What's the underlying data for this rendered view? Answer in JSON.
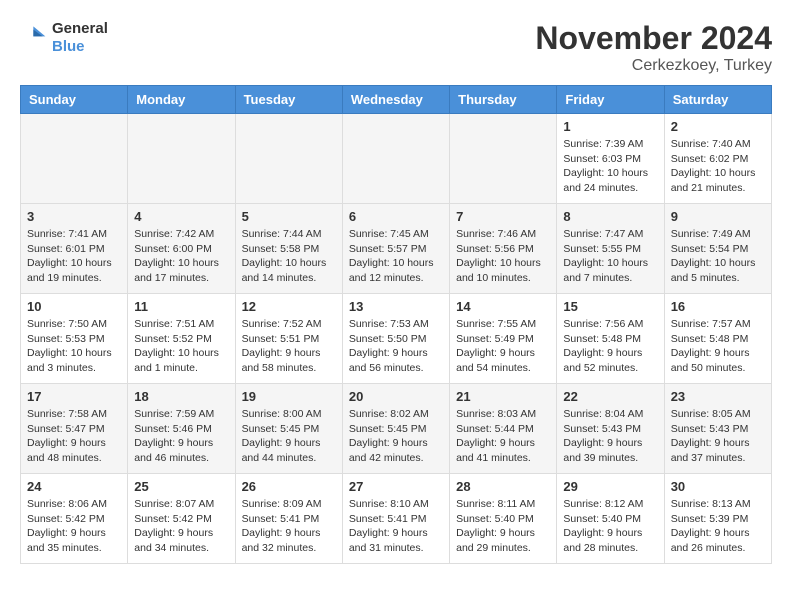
{
  "header": {
    "logo_line1": "General",
    "logo_line2": "Blue",
    "month_title": "November 2024",
    "location": "Cerkezkoey, Turkey"
  },
  "weekdays": [
    "Sunday",
    "Monday",
    "Tuesday",
    "Wednesday",
    "Thursday",
    "Friday",
    "Saturday"
  ],
  "weeks": [
    [
      {
        "day": "",
        "info": ""
      },
      {
        "day": "",
        "info": ""
      },
      {
        "day": "",
        "info": ""
      },
      {
        "day": "",
        "info": ""
      },
      {
        "day": "",
        "info": ""
      },
      {
        "day": "1",
        "info": "Sunrise: 7:39 AM\nSunset: 6:03 PM\nDaylight: 10 hours and 24 minutes."
      },
      {
        "day": "2",
        "info": "Sunrise: 7:40 AM\nSunset: 6:02 PM\nDaylight: 10 hours and 21 minutes."
      }
    ],
    [
      {
        "day": "3",
        "info": "Sunrise: 7:41 AM\nSunset: 6:01 PM\nDaylight: 10 hours and 19 minutes."
      },
      {
        "day": "4",
        "info": "Sunrise: 7:42 AM\nSunset: 6:00 PM\nDaylight: 10 hours and 17 minutes."
      },
      {
        "day": "5",
        "info": "Sunrise: 7:44 AM\nSunset: 5:58 PM\nDaylight: 10 hours and 14 minutes."
      },
      {
        "day": "6",
        "info": "Sunrise: 7:45 AM\nSunset: 5:57 PM\nDaylight: 10 hours and 12 minutes."
      },
      {
        "day": "7",
        "info": "Sunrise: 7:46 AM\nSunset: 5:56 PM\nDaylight: 10 hours and 10 minutes."
      },
      {
        "day": "8",
        "info": "Sunrise: 7:47 AM\nSunset: 5:55 PM\nDaylight: 10 hours and 7 minutes."
      },
      {
        "day": "9",
        "info": "Sunrise: 7:49 AM\nSunset: 5:54 PM\nDaylight: 10 hours and 5 minutes."
      }
    ],
    [
      {
        "day": "10",
        "info": "Sunrise: 7:50 AM\nSunset: 5:53 PM\nDaylight: 10 hours and 3 minutes."
      },
      {
        "day": "11",
        "info": "Sunrise: 7:51 AM\nSunset: 5:52 PM\nDaylight: 10 hours and 1 minute."
      },
      {
        "day": "12",
        "info": "Sunrise: 7:52 AM\nSunset: 5:51 PM\nDaylight: 9 hours and 58 minutes."
      },
      {
        "day": "13",
        "info": "Sunrise: 7:53 AM\nSunset: 5:50 PM\nDaylight: 9 hours and 56 minutes."
      },
      {
        "day": "14",
        "info": "Sunrise: 7:55 AM\nSunset: 5:49 PM\nDaylight: 9 hours and 54 minutes."
      },
      {
        "day": "15",
        "info": "Sunrise: 7:56 AM\nSunset: 5:48 PM\nDaylight: 9 hours and 52 minutes."
      },
      {
        "day": "16",
        "info": "Sunrise: 7:57 AM\nSunset: 5:48 PM\nDaylight: 9 hours and 50 minutes."
      }
    ],
    [
      {
        "day": "17",
        "info": "Sunrise: 7:58 AM\nSunset: 5:47 PM\nDaylight: 9 hours and 48 minutes."
      },
      {
        "day": "18",
        "info": "Sunrise: 7:59 AM\nSunset: 5:46 PM\nDaylight: 9 hours and 46 minutes."
      },
      {
        "day": "19",
        "info": "Sunrise: 8:00 AM\nSunset: 5:45 PM\nDaylight: 9 hours and 44 minutes."
      },
      {
        "day": "20",
        "info": "Sunrise: 8:02 AM\nSunset: 5:45 PM\nDaylight: 9 hours and 42 minutes."
      },
      {
        "day": "21",
        "info": "Sunrise: 8:03 AM\nSunset: 5:44 PM\nDaylight: 9 hours and 41 minutes."
      },
      {
        "day": "22",
        "info": "Sunrise: 8:04 AM\nSunset: 5:43 PM\nDaylight: 9 hours and 39 minutes."
      },
      {
        "day": "23",
        "info": "Sunrise: 8:05 AM\nSunset: 5:43 PM\nDaylight: 9 hours and 37 minutes."
      }
    ],
    [
      {
        "day": "24",
        "info": "Sunrise: 8:06 AM\nSunset: 5:42 PM\nDaylight: 9 hours and 35 minutes."
      },
      {
        "day": "25",
        "info": "Sunrise: 8:07 AM\nSunset: 5:42 PM\nDaylight: 9 hours and 34 minutes."
      },
      {
        "day": "26",
        "info": "Sunrise: 8:09 AM\nSunset: 5:41 PM\nDaylight: 9 hours and 32 minutes."
      },
      {
        "day": "27",
        "info": "Sunrise: 8:10 AM\nSunset: 5:41 PM\nDaylight: 9 hours and 31 minutes."
      },
      {
        "day": "28",
        "info": "Sunrise: 8:11 AM\nSunset: 5:40 PM\nDaylight: 9 hours and 29 minutes."
      },
      {
        "day": "29",
        "info": "Sunrise: 8:12 AM\nSunset: 5:40 PM\nDaylight: 9 hours and 28 minutes."
      },
      {
        "day": "30",
        "info": "Sunrise: 8:13 AM\nSunset: 5:39 PM\nDaylight: 9 hours and 26 minutes."
      }
    ]
  ]
}
